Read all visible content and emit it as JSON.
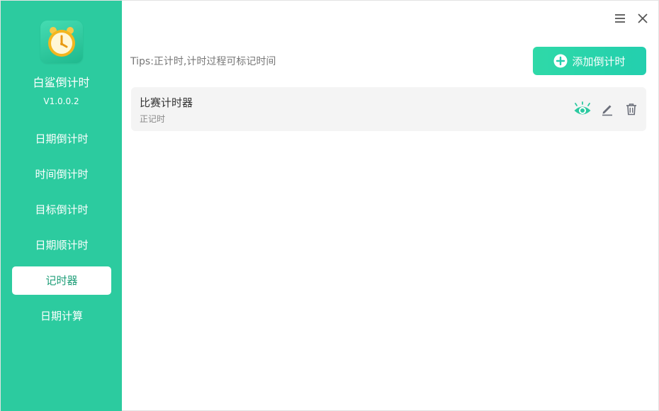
{
  "app": {
    "name": "白鲨倒计时",
    "version": "V1.0.0.2"
  },
  "sidebar": {
    "items": [
      {
        "label": "日期倒计时",
        "active": false
      },
      {
        "label": "时间倒计时",
        "active": false
      },
      {
        "label": "目标倒计时",
        "active": false
      },
      {
        "label": "日期顺计时",
        "active": false
      },
      {
        "label": "记时器",
        "active": true
      },
      {
        "label": "日期计算",
        "active": false
      }
    ]
  },
  "titlebar": {
    "icons": [
      "menu-icon",
      "close-icon"
    ]
  },
  "main": {
    "tips": "Tips:正计时,计时过程可标记时间",
    "add_button_label": "添加倒计时",
    "timers": [
      {
        "title": "比赛计时器",
        "subtitle": "正记时",
        "actions": [
          "eye-icon",
          "edit-icon",
          "delete-icon"
        ]
      }
    ]
  },
  "colors": {
    "sidebar": "#2ccb9f",
    "accent": "#23cfae",
    "active_text": "#1f9e78",
    "card_bg": "#f4f4f4"
  }
}
